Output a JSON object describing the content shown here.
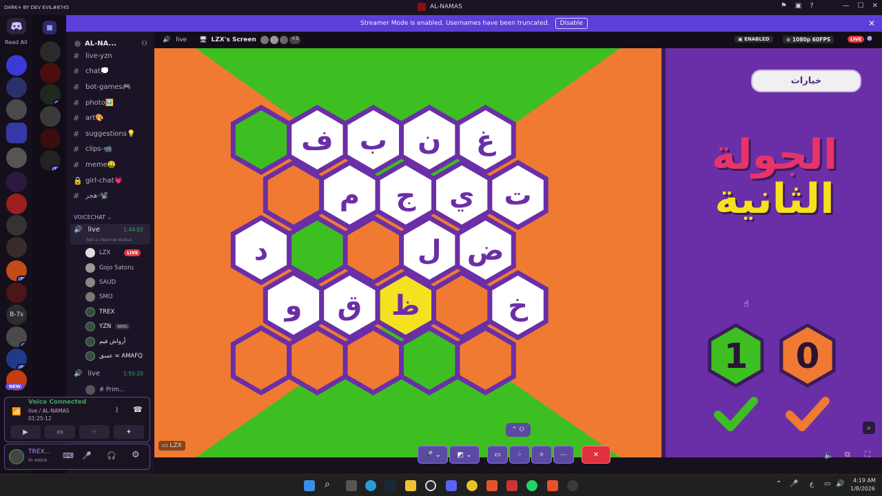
{
  "titlebar": {
    "brand": "DARK+ BY DEV EVIL#8745",
    "title": "AL-NAMAS"
  },
  "banner": {
    "text": "Streamer Mode is enabled. Usernames have been truncated.",
    "disable": "Disable"
  },
  "guilds": {
    "read_all": "Read All",
    "b7s": "B-7s",
    "new": "NEW",
    "badges": [
      "20",
      "1",
      "24",
      "6",
      "12"
    ]
  },
  "server": {
    "name": "AL-NA..."
  },
  "channels": [
    {
      "name": "live-yzn"
    },
    {
      "name": "chat💭"
    },
    {
      "name": "bot-games🎮"
    },
    {
      "name": "photo🖼️"
    },
    {
      "name": "art🎨"
    },
    {
      "name": "suggestions💡"
    },
    {
      "name": "clips-📹"
    },
    {
      "name": "meme🤑"
    },
    {
      "name": "girl-chat💗"
    },
    {
      "name": "هجر-📽️"
    }
  ],
  "voice": {
    "category": "VOICECHAT",
    "ch1": {
      "name": "live",
      "time": "1:44:02",
      "status": "Set a channel status"
    },
    "users": [
      "LZX",
      "Gojo Satoru",
      "SAUD",
      "SMO",
      "TREX",
      "YZN",
      "أرواش فيم",
      "عسق = AMAFQ"
    ],
    "live": "LIVE",
    "nms": "NMS",
    "ch2": {
      "name": "live",
      "time": "1:50:20"
    },
    "prim": "# Prim..."
  },
  "voicebox": {
    "title": "Voice Connected",
    "sub": "live / AL-NAMAS",
    "time": "01:25:12"
  },
  "userbox": {
    "name": "TREX...",
    "status": "In voice"
  },
  "streamhead": {
    "channel": "live",
    "screen": "LZX's Screen",
    "more": "+3",
    "enabled": "ENABLED",
    "quality": "1080p 60FPS",
    "live": "LIVE"
  },
  "game": {
    "options": "خيارات",
    "round_line1": "الجولة",
    "round_line2": "الثانية",
    "score_green": "1",
    "score_orange": "0",
    "stream_label": "LZX",
    "hex": [
      [
        "",
        "ف",
        "ب",
        "ن",
        "غ"
      ],
      [
        "",
        "م",
        "ج",
        "ي",
        "ت"
      ],
      [
        "د",
        "",
        "",
        "ل",
        "ض"
      ],
      [
        "",
        "و",
        "ق",
        "ظ",
        "",
        "خ"
      ],
      [
        "",
        "",
        "",
        "",
        ""
      ]
    ]
  },
  "colors": {
    "accent": "#5865f2",
    "banner": "#5c3fd6",
    "green": "#3dbf22",
    "orange": "#f07a32",
    "purple": "#6a2fa6",
    "yellow": "#f4e21e"
  },
  "taskbar": {
    "time": "4:19 AM",
    "date": "1/8/2026",
    "lang": "ع"
  }
}
